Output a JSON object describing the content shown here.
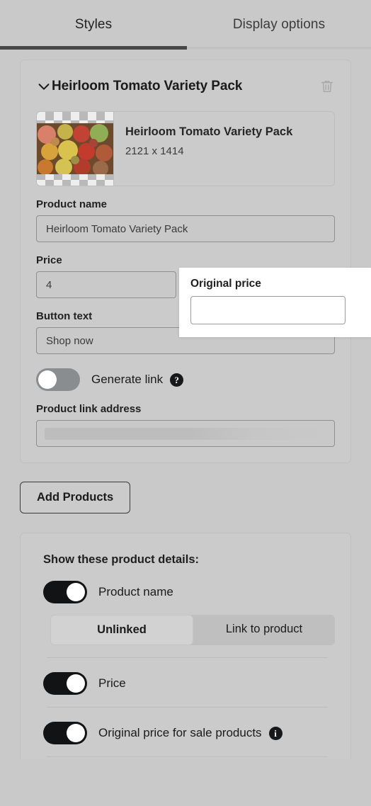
{
  "tabs": [
    {
      "label": "Styles",
      "active": true
    },
    {
      "label": "Display options",
      "active": false
    }
  ],
  "product_card": {
    "title": "Heirloom Tomato Variety Pack",
    "collapse_icon": "chevron-down-icon",
    "delete_icon": "trash-icon",
    "media": {
      "name": "Heirloom Tomato Variety Pack",
      "dimensions": "2121 x 1414"
    },
    "fields": {
      "product_name_label": "Product name",
      "product_name_value": "Heirloom Tomato Variety Pack",
      "price_label": "Price",
      "price_value": "4",
      "button_text_label": "Button text",
      "button_text_value": "Shop now",
      "product_link_label": "Product link address",
      "product_link_value": ""
    },
    "generate_link": {
      "label": "Generate link",
      "state": "off",
      "help_icon": "question-mark-icon"
    }
  },
  "overlay": {
    "label": "Original price",
    "value": "",
    "placeholder": ""
  },
  "add_products_button": "Add Products",
  "details_panel": {
    "title": "Show these product details:",
    "rows": [
      {
        "label": "Product name",
        "state": "on"
      },
      {
        "label": "Price",
        "state": "on"
      },
      {
        "label": "Original price for sale products",
        "state": "on",
        "info_icon": "info-icon"
      }
    ],
    "link_mode": {
      "options": [
        "Unlinked",
        "Link to product"
      ],
      "selected": "Unlinked"
    }
  },
  "colors": {
    "background": "#c9c9c9",
    "card": "#cbcbcb",
    "accent_underline": "#474747",
    "toggle_on": "#111315",
    "toggle_off": "#8a8d90"
  }
}
